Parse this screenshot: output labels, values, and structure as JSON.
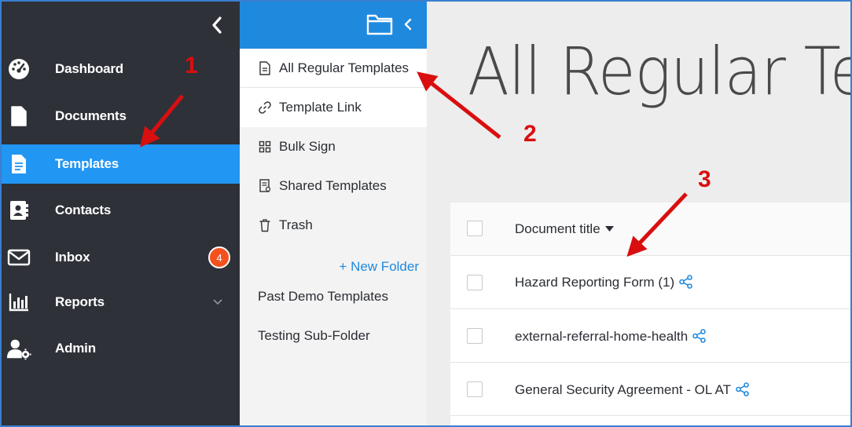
{
  "sidebar": {
    "items": [
      {
        "label": "Dashboard",
        "icon": "dashboard-icon"
      },
      {
        "label": "Documents",
        "icon": "document-icon"
      },
      {
        "label": "Templates",
        "icon": "template-icon",
        "active": true
      },
      {
        "label": "Contacts",
        "icon": "contacts-icon"
      },
      {
        "label": "Inbox",
        "icon": "mail-icon",
        "badge": "4"
      },
      {
        "label": "Reports",
        "icon": "bar-chart-icon",
        "expandable": true
      },
      {
        "label": "Admin",
        "icon": "user-gear-icon"
      }
    ],
    "collapse_icon": "chevron-left-icon"
  },
  "subpanel": {
    "header_icons": [
      "folder-icon",
      "chevron-left-icon"
    ],
    "items": [
      {
        "label": "All Regular Templates",
        "icon": "file-text-icon",
        "active": true
      },
      {
        "label": "Template Link",
        "icon": "link-icon"
      },
      {
        "label": "Bulk Sign",
        "icon": "grid-icon"
      },
      {
        "label": "Shared Templates",
        "icon": "shared-doc-icon"
      },
      {
        "label": "Trash",
        "icon": "trash-icon"
      }
    ],
    "new_folder_label": "+ New Folder",
    "folders": [
      "Past Demo Templates",
      "Testing Sub-Folder"
    ]
  },
  "main": {
    "title": "All Regular Te",
    "table": {
      "column_header": "Document title",
      "rows": [
        "Hazard Reporting Form (1)",
        "external-referral-home-health",
        "General Security Agreement - OL AT"
      ]
    }
  },
  "annotations": {
    "steps": [
      "1",
      "2",
      "3"
    ],
    "color": "#d90f0f"
  },
  "colors": {
    "sidebar_bg": "#2e3138",
    "active_blue": "#2196f3",
    "subpanel_header": "#1f89de",
    "badge": "#f4511e",
    "link_blue": "#1f89de"
  }
}
